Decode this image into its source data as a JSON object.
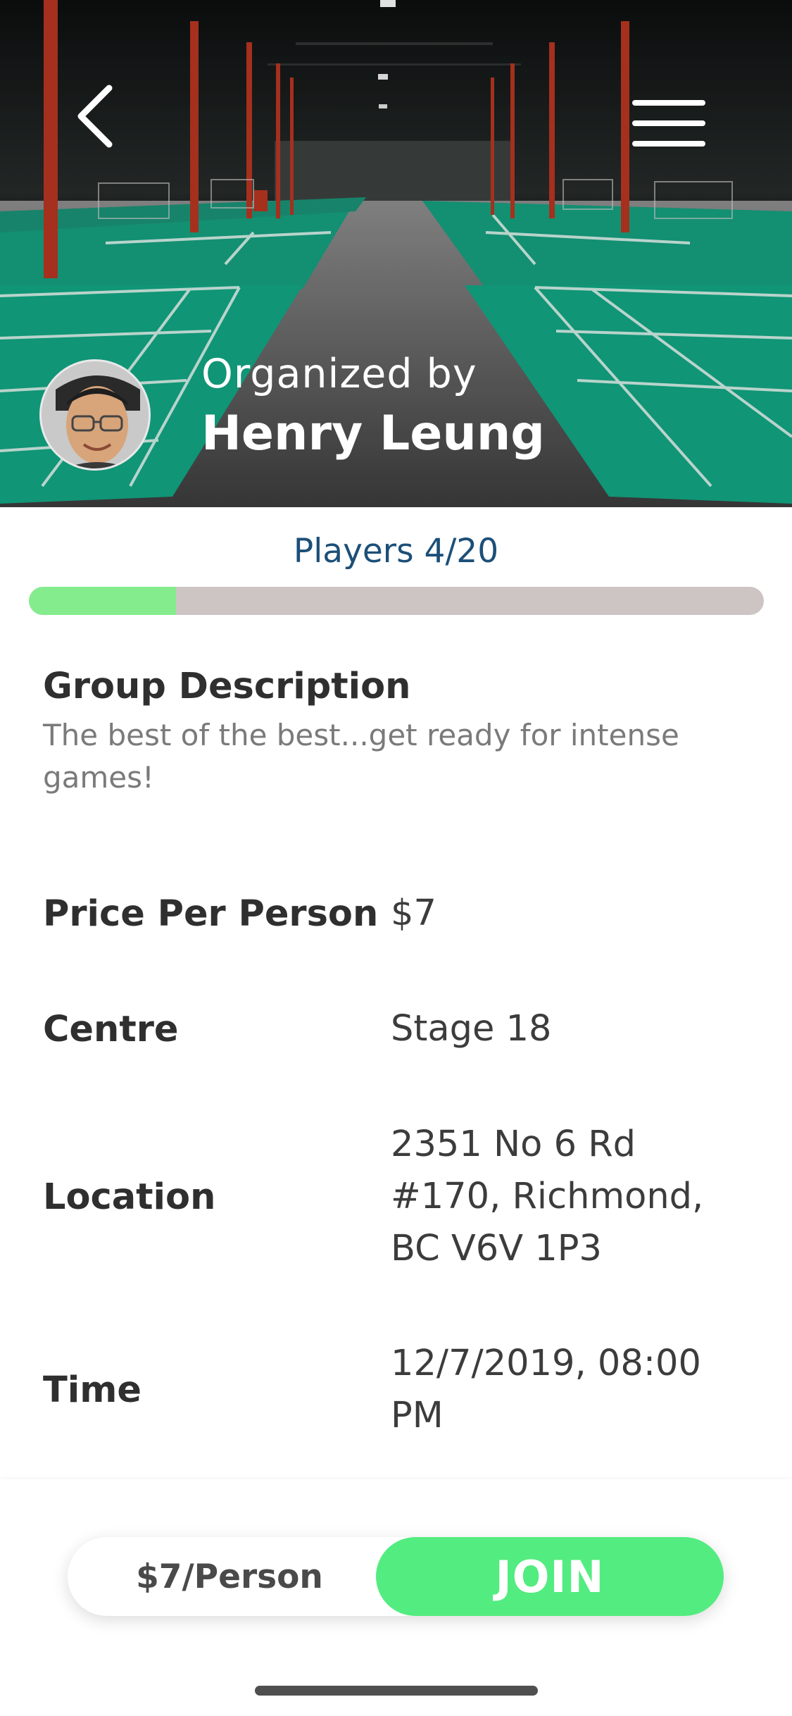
{
  "hero": {
    "organized_by_label": "Organized by",
    "organizer_name": "Henry Leung",
    "back_icon": "chevron-left-icon",
    "menu_icon": "hamburger-menu-icon"
  },
  "players": {
    "label": "Players 4/20",
    "current": 4,
    "max": 20
  },
  "description": {
    "title": "Group Description",
    "text": "The best of the best...get ready for intense games!"
  },
  "details": {
    "price": {
      "label": "Price Per Person",
      "value": "$7"
    },
    "centre": {
      "label": "Centre",
      "value": "Stage 18"
    },
    "location": {
      "label": "Location",
      "value": "2351 No 6 Rd #170, Richmond, BC V6V 1P3"
    },
    "time": {
      "label": "Time",
      "value": "12/7/2019, 08:00 PM"
    }
  },
  "footer": {
    "price_per_person": "$7/Person",
    "join_label": "JOIN"
  },
  "colors": {
    "accent_green": "#53ec80",
    "progress_fill": "#84ec8d",
    "progress_track": "#cdc4c4",
    "players_text": "#1c4f78"
  }
}
